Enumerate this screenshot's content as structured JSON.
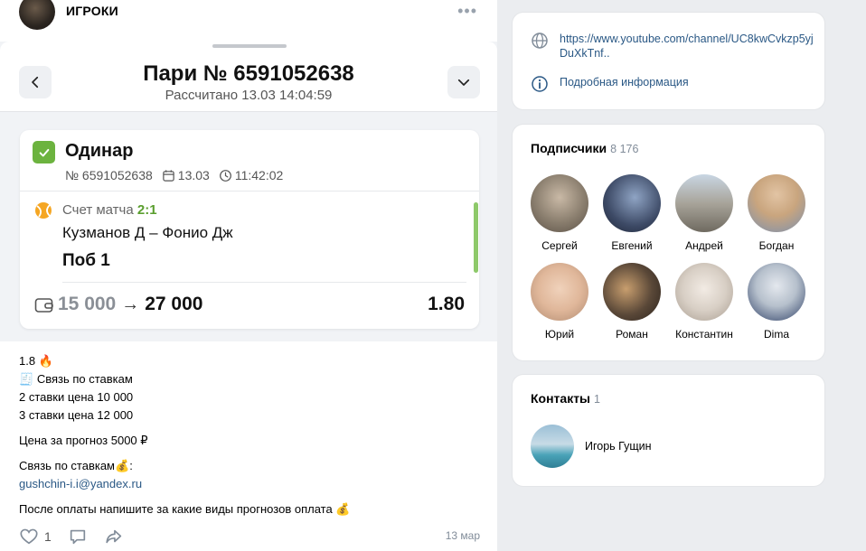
{
  "post": {
    "author": "ИГРОКИ",
    "more": "•••",
    "bet": {
      "title": "Пари № 6591052638",
      "subtitle": "Рассчитано 13.03 14:04:59",
      "type": "Одинар",
      "number": "№ 6591052638",
      "date": "13.03",
      "time": "11:42:02",
      "market_label": "Счет матча",
      "market_value": "2:1",
      "match": "Кузманов Д – Фонио Дж",
      "outcome": "Поб 1",
      "stake": "15 000",
      "arrow": "→",
      "payout": "27 000",
      "odds": "1.80"
    },
    "text": {
      "l1": "1.8",
      "l1_emoji": "🔥",
      "l2_emoji": "🧾",
      "l2": "Связь по ставкам",
      "l3": "2 ставки цена 10 000",
      "l4": "3 ставки цена 12 000",
      "l5": "Цена за прогноз 5000 ₽",
      "l6": "Связь по ставкам",
      "l6_emoji": "💰",
      "l6_suffix": ":",
      "email": "gushchin-i.i@yandex.ru",
      "l8": "После оплаты напишите за какие виды прогнозов оплата",
      "l8_emoji": "💰"
    },
    "footer": {
      "likes": "1",
      "date": "13 мар"
    }
  },
  "links": {
    "url": "https://www.youtube.com/channel/UC8kwCvkzp5yjDuXkTnf..",
    "info": "Подробная информация"
  },
  "subscribers": {
    "title": "Подписчики",
    "count": "8 176",
    "items": [
      {
        "name": "Сергей",
        "color": "#8a7e6e"
      },
      {
        "name": "Евгений",
        "color": "#3d4a66"
      },
      {
        "name": "Андрей",
        "color": "#a8a49a"
      },
      {
        "name": "Богдан",
        "color": "#c9a57e"
      },
      {
        "name": "Юрий",
        "color": "#e0b79a"
      },
      {
        "name": "Роман",
        "color": "#5a4838"
      },
      {
        "name": "Константин",
        "color": "#d8cfc5"
      },
      {
        "name": "Dima",
        "color": "#b6c0cc"
      }
    ]
  },
  "contacts": {
    "title": "Контакты",
    "count": "1",
    "name": "Игорь Гущин"
  }
}
